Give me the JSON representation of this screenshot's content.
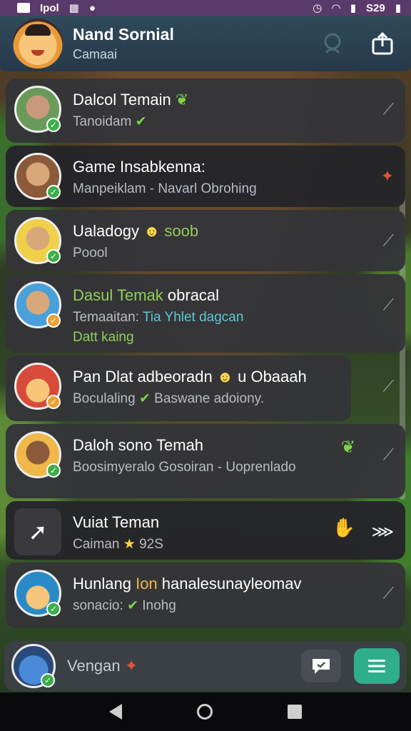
{
  "status_bar": {
    "left_icons": [
      "image-icon",
      "signal-text-icon",
      "grid-icon",
      "chat-bubble-icon"
    ],
    "left_text": "Ipol",
    "time": "S29"
  },
  "header": {
    "title": "Nand Sornial",
    "subtitle": "Camaai"
  },
  "chats": [
    {
      "name": "Dalcol Temain",
      "subtitle": "Tanoidam",
      "avatar_color": "#6a9a5a",
      "status": "online"
    },
    {
      "name": "Game Insabkenna:",
      "subtitle": "Manpeiklam - Navarl Obrohing",
      "avatar_color": "#c89a6a",
      "status": "online"
    },
    {
      "name": "Ualadogy",
      "name_suffix": "soob",
      "subtitle": "Poool",
      "avatar_color": "#f0d04a",
      "status": "online"
    },
    {
      "name": "Dasul Temak",
      "name_suffix": "obracal",
      "subtitle": "Temaaitan: ",
      "subtitle_hl": "Tia Yhlet dagcan",
      "subtitle_2": "Datt kaing",
      "avatar_color": "#4aa0d8",
      "status": "away"
    },
    {
      "name": "Pan Dlat adbeoradn",
      "name_suffix": "u Obaaah",
      "subtitle": "Boculaling",
      "subtitle_extra": "Baswane adoiony.",
      "avatar_color": "#d84a3a",
      "status": "away"
    },
    {
      "name": "Daloh sono Temah",
      "subtitle": "Boosimyeralo Gosoiran - Uoprenlado",
      "avatar_color": "#f0b84a",
      "status": "online"
    },
    {
      "name": "Vuiat Teman",
      "subtitle": "Caiman",
      "subtitle_extra": "92S",
      "avatar_color": "#3a3a3e",
      "status": "none"
    },
    {
      "name": "Hunlang",
      "name_hl": "Ion",
      "name_suffix": "hanalesunayleomav",
      "subtitle": "sonacio:",
      "subtitle_extra": "Inohg",
      "avatar_color": "#2a8ac8",
      "status": "online"
    }
  ],
  "bottom_bar": {
    "label": "Vengan"
  },
  "nav": {
    "back": "back",
    "home": "home",
    "recents": "recents"
  },
  "colors": {
    "accent": "#2fae8a",
    "online": "#3cae4a",
    "away": "#f0a030",
    "highlight_green": "#8fd05a"
  }
}
